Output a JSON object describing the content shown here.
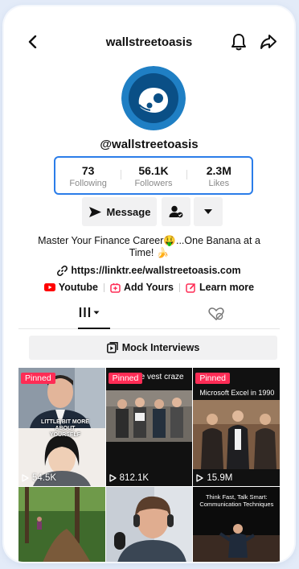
{
  "header": {
    "title": "wallstreetoasis"
  },
  "profile": {
    "handle": "@wallstreetoasis",
    "stats": [
      {
        "value": "73",
        "label": "Following"
      },
      {
        "value": "56.1K",
        "label": "Followers"
      },
      {
        "value": "2.3M",
        "label": "Likes"
      }
    ],
    "message_label": "Message",
    "bio": "Master Your Finance Career🤑...One Banana at a Time! 🍌",
    "link": "https://linktr.ee/wallstreetoasis.com",
    "socials": [
      {
        "label": "Youtube",
        "icon": "youtube-icon",
        "color": "#ff0000"
      },
      {
        "label": "Add Yours",
        "icon": "add-yours-icon",
        "color": "#fe2c55"
      },
      {
        "label": "Learn more",
        "icon": "edit-icon",
        "color": "#fe2c55"
      }
    ]
  },
  "playlist": {
    "label": "Mock Interviews"
  },
  "videos": [
    {
      "pinned": "Pinned",
      "views": "54.5K",
      "caption": "LITTLE BIT MORE ABOUT YOURSELF"
    },
    {
      "pinned": "Pinned",
      "views": "812.1K",
      "caption": "ce vest craze"
    },
    {
      "pinned": "Pinned",
      "views": "15.9M",
      "caption": "Microsoft Excel in 1990"
    },
    {
      "caption": ""
    },
    {
      "caption": ""
    },
    {
      "caption": "Think Fast, Talk Smart: Communication Techniques"
    }
  ],
  "colors": {
    "accent": "#fe2c55",
    "highlight": "#2b7de9"
  }
}
